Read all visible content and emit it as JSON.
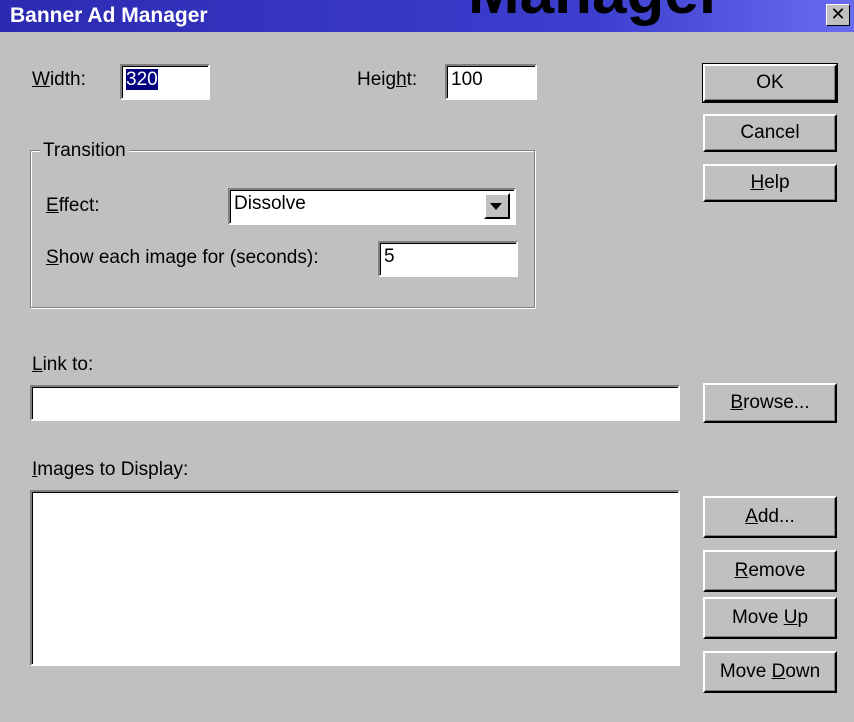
{
  "window": {
    "title": "Banner Ad Manager",
    "title_background_text": "Manager",
    "close_label": "✕"
  },
  "size": {
    "width_label": "Width:",
    "width_value": "320",
    "height_label": "Height:",
    "height_value": "100"
  },
  "transition": {
    "legend": "Transition",
    "effect_label": "Effect:",
    "effect_value": "Dissolve",
    "show_label": "Show each image for (seconds):",
    "show_value": "5"
  },
  "link": {
    "label": "Link to:",
    "value": "",
    "browse_label": "Browse..."
  },
  "images": {
    "label": "Images to Display:",
    "items": []
  },
  "buttons": {
    "ok": "OK",
    "cancel": "Cancel",
    "help": "Help",
    "add": "Add...",
    "remove": "Remove",
    "move_up": "Move Up",
    "move_down": "Move Down"
  }
}
